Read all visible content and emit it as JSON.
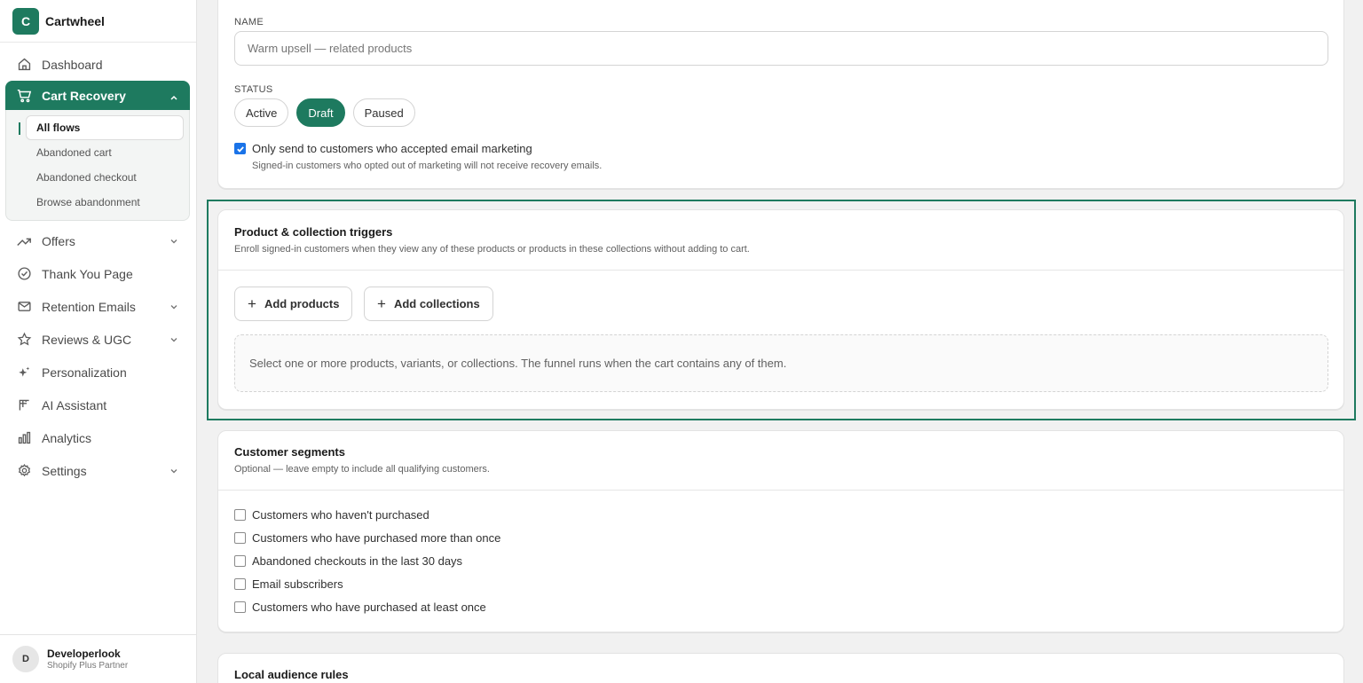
{
  "app": {
    "logo_letter": "C",
    "name": "Cartwheel"
  },
  "nav": {
    "dashboard": "Dashboard",
    "cart_recovery": "Cart Recovery",
    "sub": [
      "All flows",
      "Abandoned cart",
      "Abandoned checkout",
      "Browse abandonment"
    ],
    "offers": "Offers",
    "thank_you": "Thank You Page",
    "retention": "Retention Emails",
    "reviews": "Reviews & UGC",
    "personalization": "Personalization",
    "ai": "AI Assistant",
    "analytics": "Analytics",
    "settings": "Settings"
  },
  "user": {
    "initial": "D",
    "name": "Developerlook",
    "role": "Shopify Plus Partner"
  },
  "form": {
    "name_label": "NAME",
    "name_placeholder": "Warm upsell — related products",
    "status_label": "STATUS",
    "status_options": [
      "Active",
      "Draft",
      "Paused"
    ],
    "status_selected": "Draft",
    "marketing_check": "Only send to customers who accepted email marketing",
    "marketing_checked": true,
    "marketing_hint": "Signed-in customers who opted out of marketing will not receive recovery emails."
  },
  "triggers": {
    "title": "Product & collection triggers",
    "subtitle": "Enroll signed-in customers when they view any of these products or products in these collections without adding to cart.",
    "add_products": "Add products",
    "add_collections": "Add collections",
    "empty": "Select one or more products, variants, or collections. The funnel runs when the cart contains any of them."
  },
  "segments": {
    "title": "Customer segments",
    "subtitle": "Optional — leave empty to include all qualifying customers.",
    "options": [
      "Customers who haven't purchased",
      "Customers who have purchased more than once",
      "Abandoned checkouts in the last 30 days",
      "Email subscribers",
      "Customers who have purchased at least once"
    ]
  },
  "local": {
    "title": "Local audience rules"
  },
  "colors": {
    "accent": "#1e7a5f",
    "checkbox": "#1a73e8"
  }
}
